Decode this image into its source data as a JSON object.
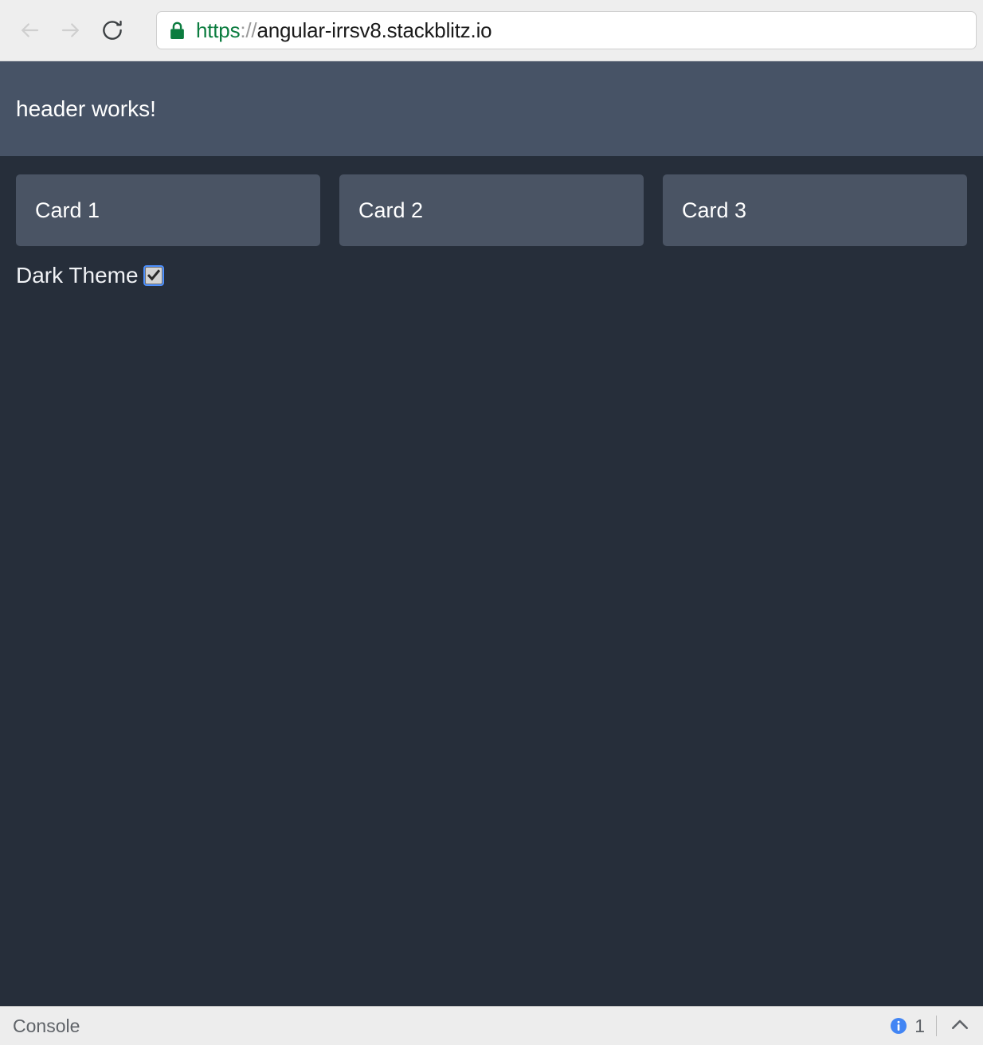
{
  "browser": {
    "back_icon": "arrow-left-icon",
    "forward_icon": "arrow-right-icon",
    "reload_icon": "reload-icon",
    "lock_icon": "lock-icon",
    "url": {
      "full": "https://angular-irrsv8.stackblitz.io",
      "scheme": "https",
      "separator": "://",
      "host": "angular-irrsv8.stackblitz.io"
    },
    "colors": {
      "chrome_bg": "#eeeeee",
      "scheme_green": "#0b7c3f",
      "separator_gray": "#9a9a9a"
    }
  },
  "app": {
    "header": {
      "title": "header works!",
      "bg": "#475366"
    },
    "body": {
      "bg": "#262e3a"
    },
    "cards": [
      {
        "label": "Card 1"
      },
      {
        "label": "Card 2"
      },
      {
        "label": "Card 3"
      }
    ],
    "theme_toggle": {
      "label": "Dark Theme",
      "checked": "true",
      "focus_color": "#4d90fe"
    }
  },
  "console": {
    "title": "Console",
    "info_icon": "info-circle-icon",
    "count": "1",
    "info_color": "#4285f4",
    "toggle_icon": "chevron-up-icon",
    "bg": "#ededed"
  }
}
